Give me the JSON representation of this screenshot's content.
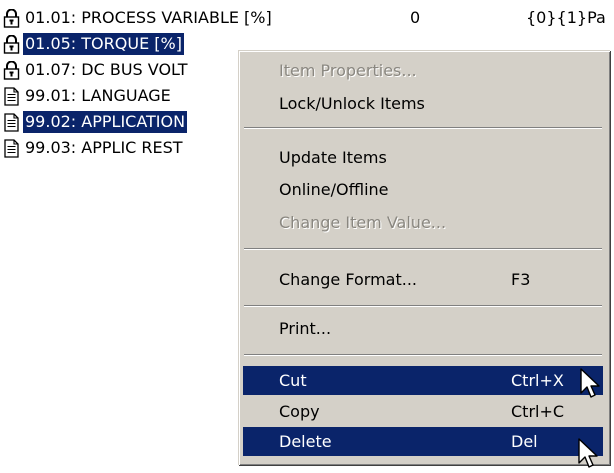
{
  "items": [
    {
      "label": "01.01: PROCESS VARIABLE [%]",
      "value": "0",
      "format": "{0}{1}Pa",
      "icon": "lock-closed-icon",
      "selected": false
    },
    {
      "label": "01.05: TORQUE [%]",
      "value": "",
      "format": "",
      "icon": "lock-closed-icon",
      "selected": true
    },
    {
      "label": "01.07: DC BUS VOLT",
      "value": "",
      "format": "",
      "icon": "lock-closed-icon",
      "selected": false
    },
    {
      "label": "99.01: LANGUAGE",
      "value": "",
      "format": "",
      "icon": "document-icon",
      "selected": false
    },
    {
      "label": "99.02: APPLICATION",
      "value": "",
      "format": "",
      "icon": "document-icon",
      "selected": true
    },
    {
      "label": "99.03: APPLIC REST",
      "value": "",
      "format": "",
      "icon": "document-icon",
      "selected": false
    }
  ],
  "menu": {
    "item_properties": {
      "label": "Item Properties..."
    },
    "lock_unlock": {
      "label": "Lock/Unlock Items"
    },
    "update_items": {
      "label": "Update Items"
    },
    "online_offline": {
      "label": "Online/Offline"
    },
    "change_item_value": {
      "label": "Change Item Value..."
    },
    "change_format": {
      "label": "Change Format...",
      "shortcut": "F3"
    },
    "print": {
      "label": "Print..."
    },
    "cut": {
      "label": "Cut",
      "shortcut": "Ctrl+X"
    },
    "copy": {
      "label": "Copy",
      "shortcut": "Ctrl+C"
    },
    "delete": {
      "label": "Delete",
      "shortcut": "Del"
    }
  },
  "colors": {
    "selection": "#0a246a",
    "menu_bg": "#d4d0c8"
  }
}
